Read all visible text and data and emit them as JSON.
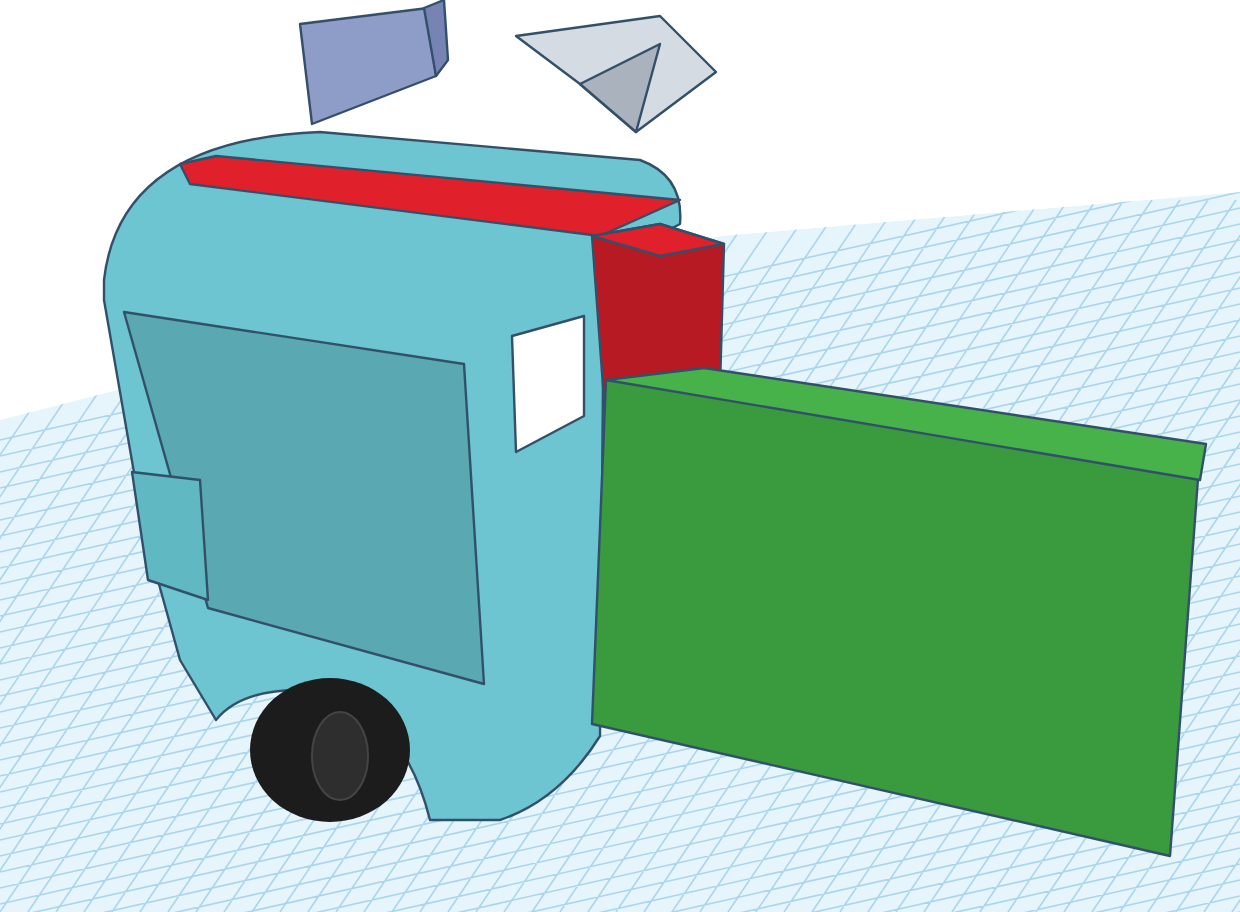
{
  "workplane": {
    "kind": "grid"
  },
  "shapes": [
    {
      "kind": "panel",
      "color": "#8e9cc8"
    },
    {
      "kind": "wedge",
      "color": "#d5dbe2"
    },
    {
      "kind": "cab",
      "color": "#6cc5d0"
    },
    {
      "kind": "bar",
      "color": "#e0202a"
    },
    {
      "kind": "block",
      "color": "#b81a24"
    },
    {
      "kind": "box",
      "color": "#3a9a3e"
    }
  ]
}
